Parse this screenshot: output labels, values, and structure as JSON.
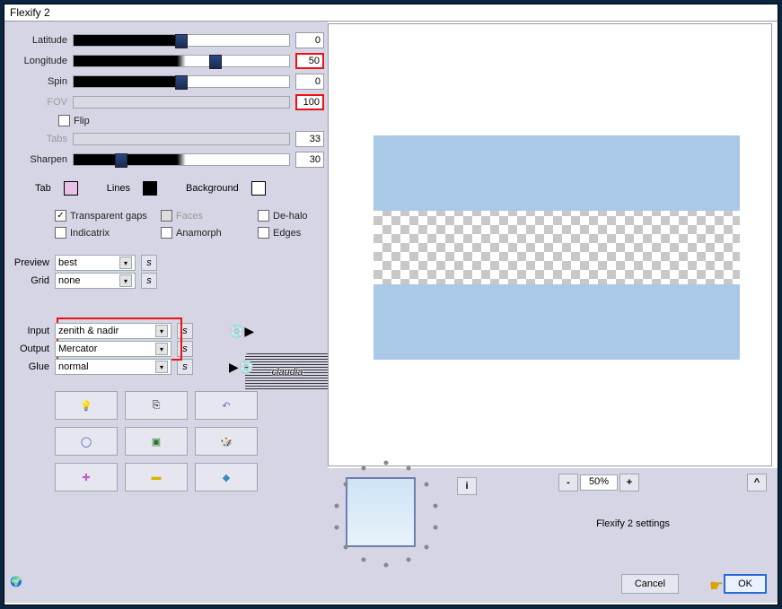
{
  "window": {
    "title": "Flexify 2"
  },
  "sliders": {
    "latitude": {
      "label": "Latitude",
      "value": "0",
      "pos": 50,
      "disabled": false
    },
    "longitude": {
      "label": "Longitude",
      "value": "50",
      "pos": 66,
      "disabled": false,
      "highlight": true
    },
    "spin": {
      "label": "Spin",
      "value": "0",
      "pos": 50,
      "disabled": false
    },
    "fov": {
      "label": "FOV",
      "value": "100",
      "pos": 0,
      "disabled": true,
      "highlight": true
    },
    "tabs": {
      "label": "Tabs",
      "value": "33",
      "pos": 0,
      "disabled": true
    },
    "sharpen": {
      "label": "Sharpen",
      "value": "30",
      "pos": 22,
      "disabled": false
    }
  },
  "flip": {
    "label": "Flip",
    "checked": false
  },
  "colors": {
    "tab": {
      "label": "Tab",
      "hex": "#e8c0e8"
    },
    "lines": {
      "label": "Lines",
      "hex": "#000000"
    },
    "background": {
      "label": "Background",
      "hex": "#ffffff"
    }
  },
  "options": {
    "transparent_gaps": {
      "label": "Transparent gaps",
      "checked": true
    },
    "faces": {
      "label": "Faces",
      "checked": false,
      "disabled": true
    },
    "dehalo": {
      "label": "De-halo",
      "checked": false
    },
    "indicatrix": {
      "label": "Indicatrix",
      "checked": false
    },
    "anamorph": {
      "label": "Anamorph",
      "checked": false
    },
    "edges": {
      "label": "Edges",
      "checked": false
    }
  },
  "selects": {
    "preview": {
      "label": "Preview",
      "value": "best"
    },
    "grid": {
      "label": "Grid",
      "value": "none"
    },
    "input": {
      "label": "Input",
      "value": "zenith & nadir",
      "highlight": true
    },
    "output": {
      "label": "Output",
      "value": "Mercator",
      "highlight": true
    },
    "glue": {
      "label": "Glue",
      "value": "normal"
    }
  },
  "watermark": "claudia",
  "tool_icons": [
    "lightbulb",
    "copy",
    "undo",
    "ring",
    "chip",
    "dice",
    "plus",
    "brick",
    "gem"
  ],
  "zoom": {
    "value": "50%",
    "minus": "-",
    "plus": "+"
  },
  "settings_text": "Flexify 2 settings",
  "buttons": {
    "cancel": "Cancel",
    "ok": "OK"
  },
  "info": "i",
  "expand": "^"
}
